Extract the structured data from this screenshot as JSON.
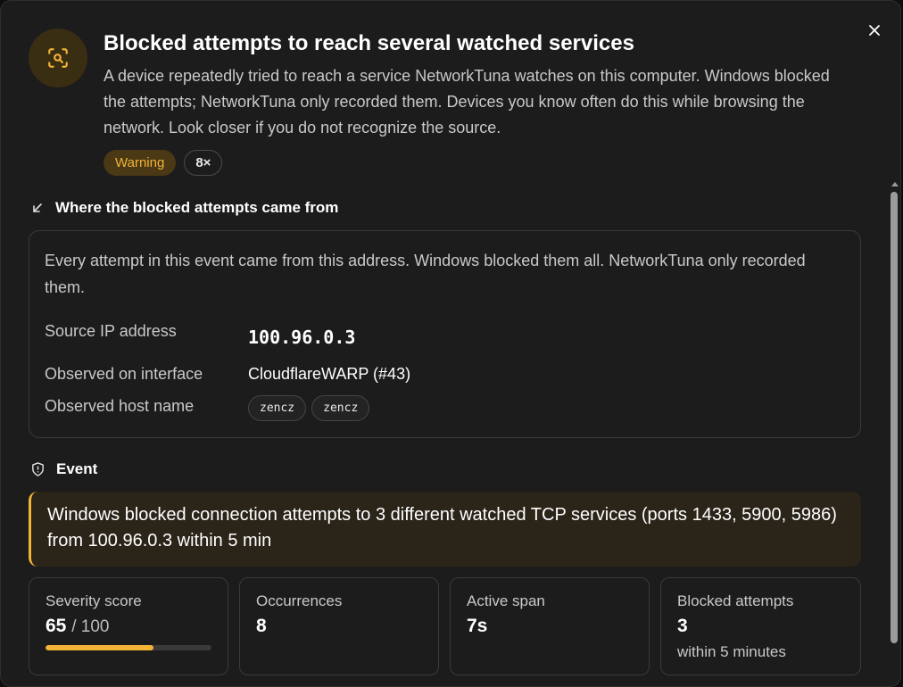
{
  "header": {
    "title": "Blocked attempts to reach several watched services",
    "description": "A device repeatedly tried to reach a service NetworkTuna watches on this computer. Windows blocked the attempts; NetworkTuna only recorded them. Devices you know often do this while browsing the network. Look closer if you do not recognize the source.",
    "icon": "scan-search-icon",
    "badges": {
      "severity": "Warning",
      "count": "8×"
    }
  },
  "source": {
    "heading": "Where the blocked attempts came from",
    "heading_icon": "arrow-down-left-icon",
    "text": "Every attempt in this event came from this address. Windows blocked them all. NetworkTuna only recorded them.",
    "rows": {
      "ip_label": "Source IP address",
      "ip_value": "100.96.0.3",
      "interface_label": "Observed on interface",
      "interface_value": "CloudflareWARP (#43)",
      "host_label": "Observed host name",
      "hosts": [
        "zencz",
        "zencz"
      ]
    }
  },
  "event": {
    "heading": "Event",
    "heading_icon": "shield-alert-icon",
    "summary": "Windows blocked connection attempts to 3 different watched TCP services (ports 1433, 5900, 5986) from 100.96.0.3 within 5 min"
  },
  "stats": {
    "severity": {
      "label": "Severity score",
      "value": "65",
      "of": "/ 100",
      "fraction": 0.65
    },
    "occurrences": {
      "label": "Occurrences",
      "value": "8"
    },
    "active_span": {
      "label": "Active span",
      "value": "7s"
    },
    "blocked": {
      "label": "Blocked attempts",
      "value": "3",
      "sub": "within 5 minutes"
    }
  },
  "colors": {
    "accent": "#f2b337",
    "warning_bg": "#4a3914",
    "surface": "#1c1c1c",
    "border": "#3a3a3a"
  }
}
